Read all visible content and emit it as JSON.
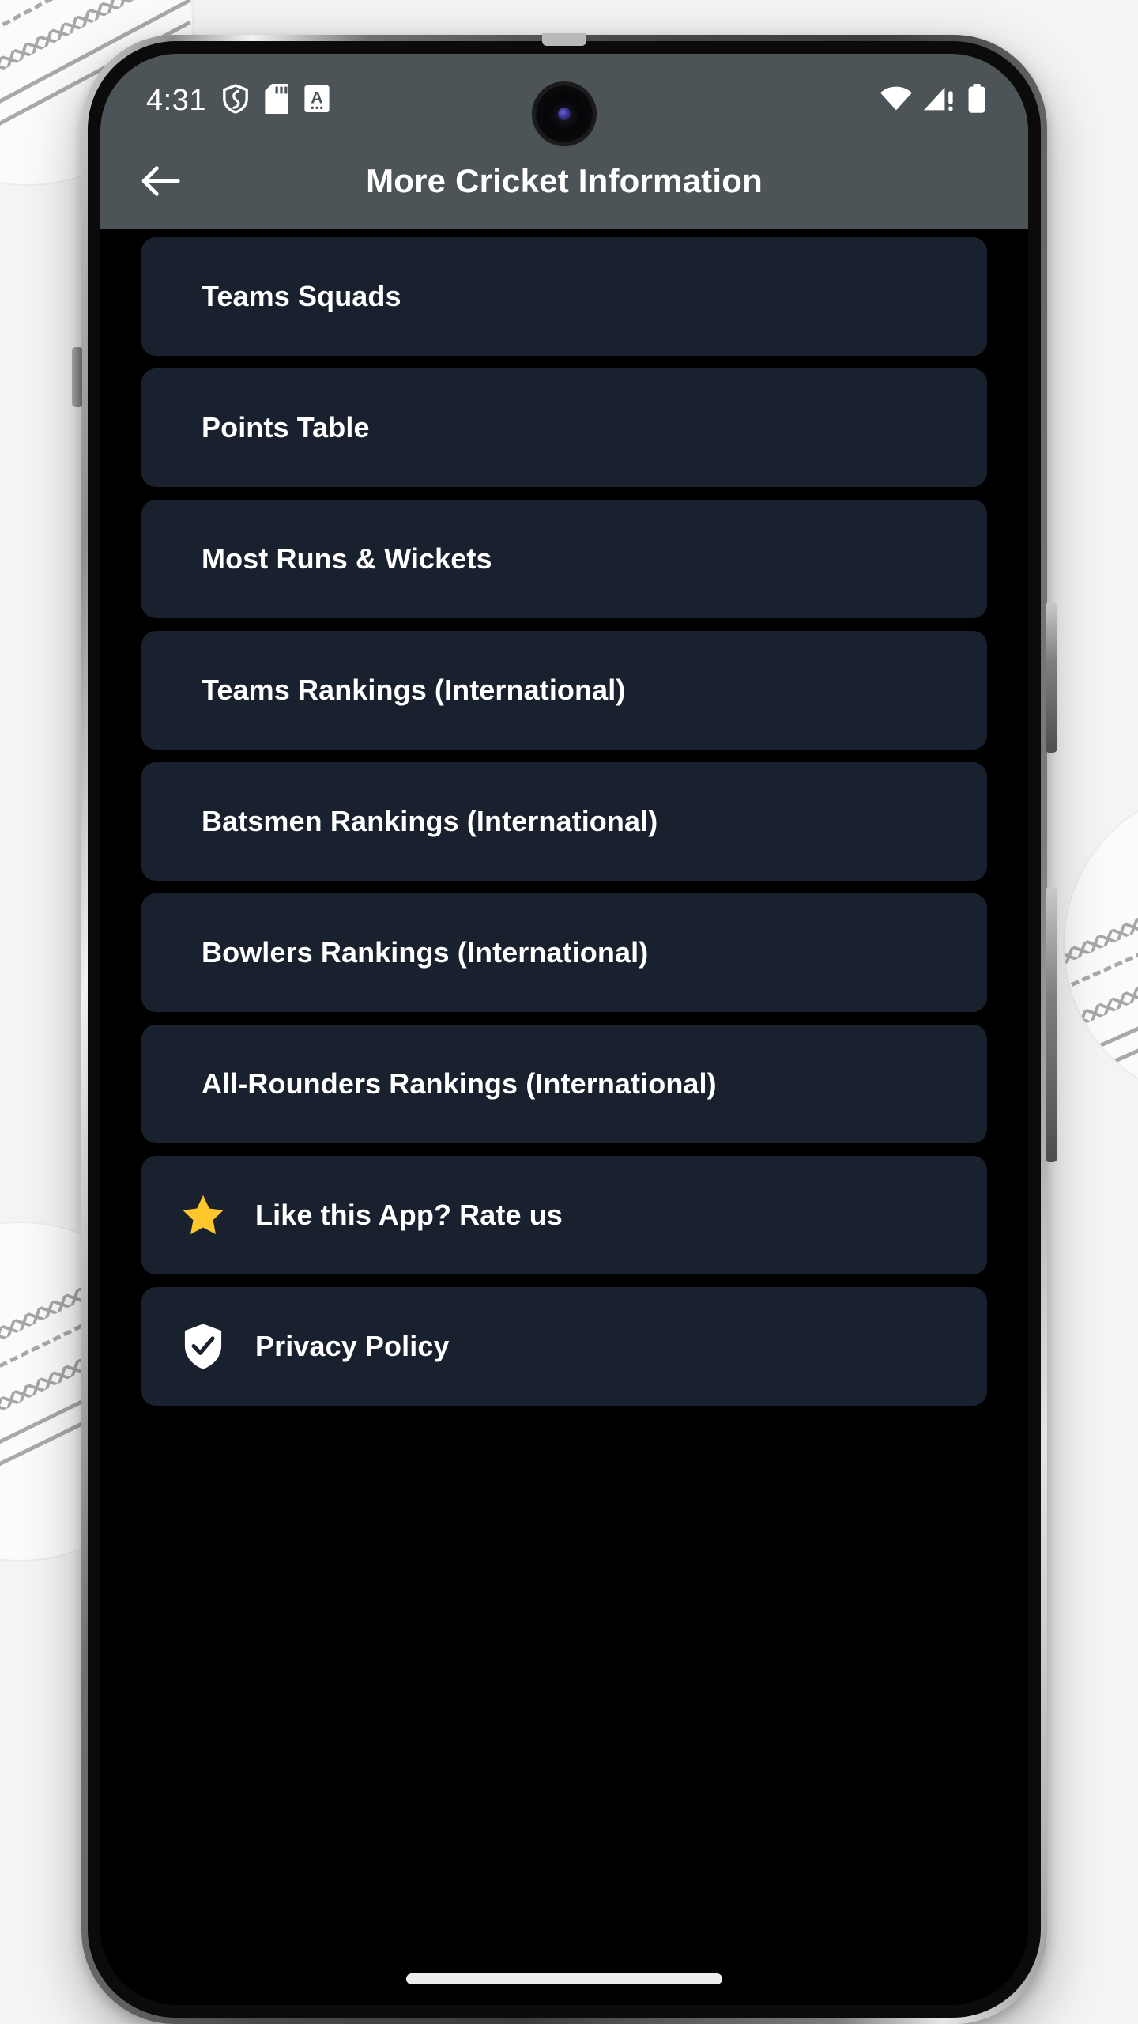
{
  "background": {
    "page_bg": "#f4f4f4",
    "decor": "cricket-ball-seam-pattern"
  },
  "device": {
    "frame_color": "#3c3c3c",
    "buttons": [
      "volume-rocker-left",
      "volume-rocker-right",
      "power-button-right"
    ]
  },
  "status_bar": {
    "time": "4:31",
    "left_icons": [
      "shield-icon",
      "sd-card-icon",
      "font-size-a-icon"
    ],
    "right_icons": [
      "wifi-icon",
      "cellular-signal-alert-icon",
      "battery-icon"
    ],
    "background_color": "#4c5458",
    "foreground_color": "#ffffff"
  },
  "camera": {
    "type": "punch-hole-camera"
  },
  "app_bar": {
    "back_icon": "arrow-left-icon",
    "title": "More Cricket Information",
    "background_color": "#4c5458"
  },
  "menu": {
    "card_color": "#18212d",
    "items": [
      {
        "label": "Teams Squads",
        "icon": null
      },
      {
        "label": "Points Table",
        "icon": null
      },
      {
        "label": "Most Runs & Wickets",
        "icon": null
      },
      {
        "label": "Teams Rankings (International)",
        "icon": null
      },
      {
        "label": "Batsmen Rankings (International)",
        "icon": null
      },
      {
        "label": "Bowlers Rankings (International)",
        "icon": null
      },
      {
        "label": "All-Rounders Rankings (International)",
        "icon": null
      },
      {
        "label": "Like this App? Rate us",
        "icon": "star-icon",
        "icon_color": "#ffc72c"
      },
      {
        "label": "Privacy Policy",
        "icon": "shield-check-icon",
        "icon_color": "#ffffff"
      }
    ]
  },
  "navigation": {
    "home_indicator": "gesture-home-bar"
  }
}
